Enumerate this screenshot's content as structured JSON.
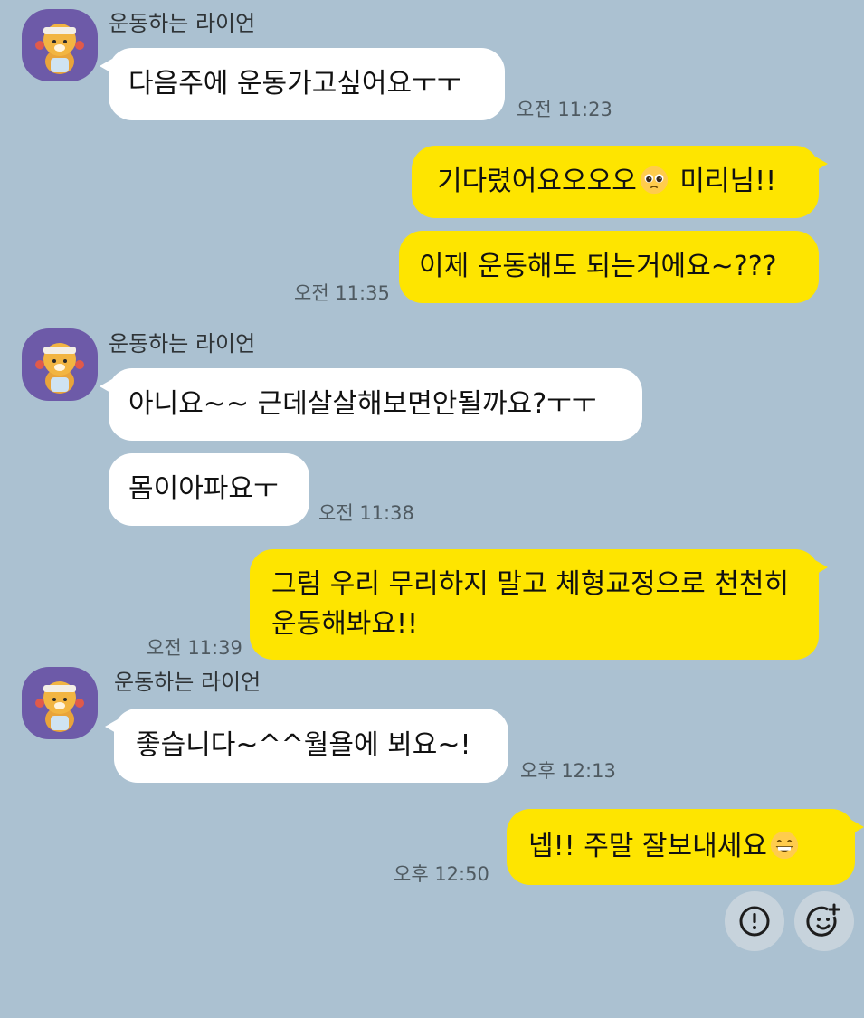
{
  "conversation": {
    "groups": [
      {
        "sender": "운동하는 라이언",
        "messages": [
          "다음주에 운동가고싶어요ㅜㅜ"
        ],
        "time": "오전 11:23"
      },
      {
        "messages": [
          {
            "before": "기다렸어요오오오",
            "emoji": "pleading-face-emoji",
            "after": " 미리님!!"
          },
          {
            "text": "이제 운동해도 되는거에요~???"
          }
        ],
        "time": "오전 11:35"
      },
      {
        "sender": "운동하는 라이언",
        "messages": [
          "아니요~~ 근데살살해보면안될까요?ㅜㅜ",
          "몸이아파요ㅜ"
        ],
        "time": "오전 11:38"
      },
      {
        "messages": [
          {
            "text": "그럼 우리 무리하지 말고 체형교정으로 천천히 운동해봐요!!"
          }
        ],
        "time": "오전 11:39"
      },
      {
        "sender": "운동하는 라이언",
        "messages": [
          "좋습니다~^^월욜에 뵈요~!"
        ],
        "time": "오후 12:13"
      },
      {
        "messages": [
          {
            "before": "넵!! 주말 잘보내세요",
            "emoji": "grinning-face-emoji"
          }
        ],
        "time": "오후 12:50"
      }
    ]
  },
  "actions": {
    "report_icon": "exclamation-circle-icon",
    "add_reaction_icon": "add-emoji-icon"
  },
  "colors": {
    "background": "#abc1d1",
    "incoming_bubble": "#ffffff",
    "outgoing_bubble": "#fee500",
    "avatar_bg": "#6d5aa8"
  }
}
